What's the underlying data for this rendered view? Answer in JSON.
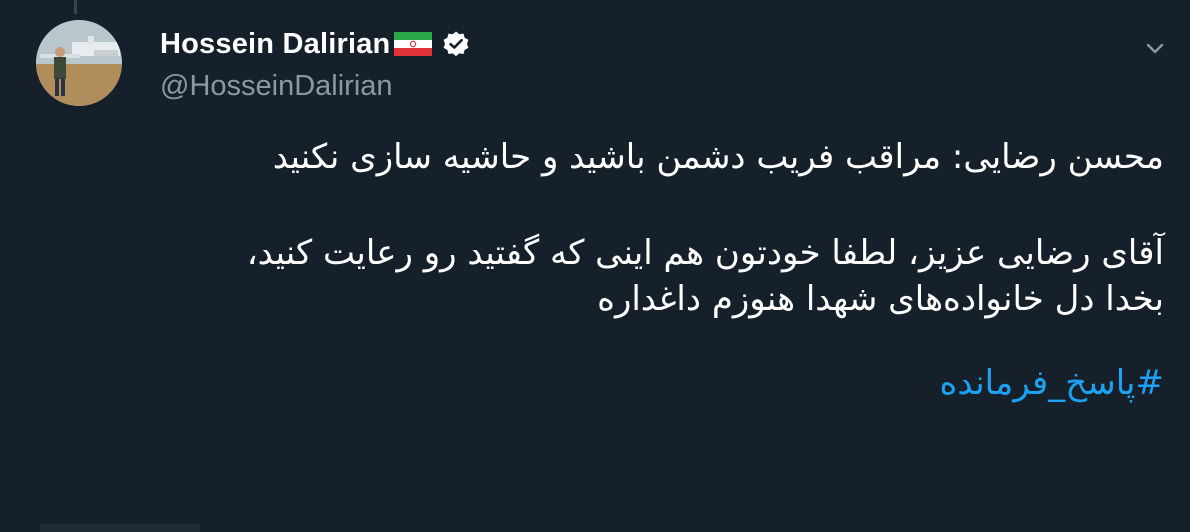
{
  "author": {
    "display_name": "Hossein Dalirian",
    "handle": "@HosseinDalirian",
    "flag_icon": "iran-flag-icon",
    "verified_icon": "verified-badge-icon"
  },
  "tweet": {
    "line1": "محسن رضایی: مراقب فریب دشمن باشید و حاشیه سازی نکنید",
    "line2": "آقای رضایی عزیز، لطفا خودتون هم اینی که گفتید رو رعایت کنید،",
    "line3": "بخدا دل خانواده‌های شهدا هنوزم داغداره",
    "hashtag": "#پاسخ_فرمانده"
  },
  "menu": {
    "caret_icon": "chevron-down-icon"
  },
  "colors": {
    "background": "#15202b",
    "text": "#ffffff",
    "secondary": "#8899a6",
    "link": "#1da1f2",
    "verified": "#ffffff"
  }
}
